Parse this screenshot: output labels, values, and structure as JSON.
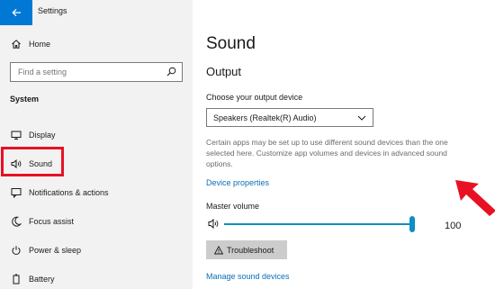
{
  "window": {
    "title": "Settings"
  },
  "sidebar": {
    "home_label": "Home",
    "search_placeholder": "Find a setting",
    "section_header": "System",
    "items": [
      {
        "label": "Display",
        "icon": "monitor-icon"
      },
      {
        "label": "Sound",
        "icon": "speaker-icon",
        "selected": true
      },
      {
        "label": "Notifications & actions",
        "icon": "notification-icon"
      },
      {
        "label": "Focus assist",
        "icon": "moon-icon"
      },
      {
        "label": "Power & sleep",
        "icon": "power-icon"
      },
      {
        "label": "Battery",
        "icon": "battery-icon"
      }
    ]
  },
  "main": {
    "page_title": "Sound",
    "output_section_title": "Output",
    "output_device_label": "Choose your output device",
    "output_device_value": "Speakers (Realtek(R) Audio)",
    "description": "Certain apps may be set up to use different sound devices than the one selected here. Customize app volumes and devices in advanced sound options.",
    "device_properties_link": "Device properties",
    "master_volume_label": "Master volume",
    "master_volume_value": "100",
    "troubleshoot_label": "Troubleshoot",
    "manage_devices_link": "Manage sound devices"
  },
  "colors": {
    "accent": "#0078d4",
    "link": "#0a6fb8",
    "slider": "#0f8fc2",
    "highlight": "#e81123",
    "annotation_arrow": "#e81123"
  }
}
